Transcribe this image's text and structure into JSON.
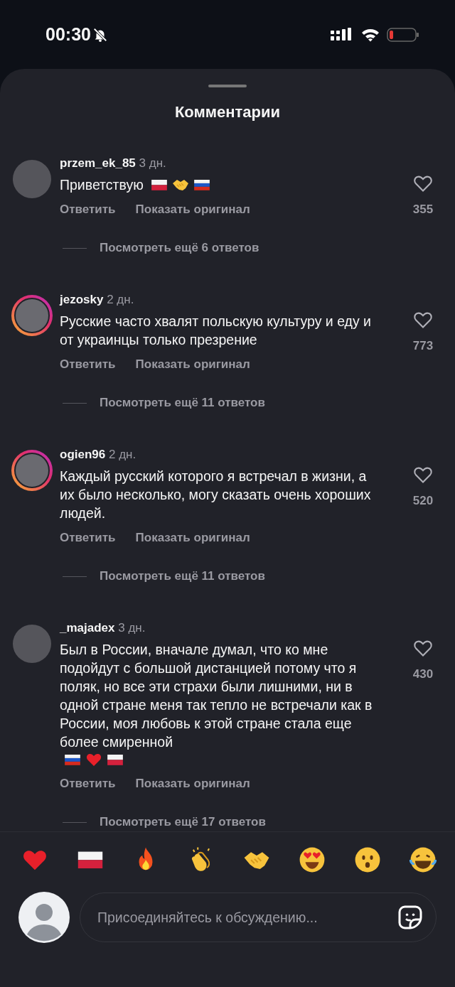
{
  "status_bar": {
    "time": "00:30",
    "silent": true
  },
  "sheet": {
    "title": "Комментарии"
  },
  "comments": [
    {
      "username": "przem_ek_85",
      "age": "3 дн.",
      "story_ring": false,
      "text": "Приветствую",
      "emojis": [
        {
          "kind": "flag-pl"
        },
        {
          "kind": "handshake"
        },
        {
          "kind": "flag-ru"
        }
      ],
      "reply": "Ответить",
      "translate": "Показать оригинал",
      "likes": "355",
      "liked": false,
      "more_replies": "Посмотреть ещё 6 ответов"
    },
    {
      "username": "jezosky",
      "age": "2 дн.",
      "story_ring": true,
      "text": "Русские часто хвалят польскую культуру и еду и от украинцы только презрение",
      "reply": "Ответить",
      "translate": "Показать оригинал",
      "likes": "773",
      "liked": false,
      "more_replies": "Посмотреть ещё 11 ответов"
    },
    {
      "username": "ogien96",
      "age": "2 дн.",
      "story_ring": true,
      "text": "Каждый русский которого я встречал в жизни, а их было несколько, могу сказать очень хороших людей.",
      "reply": "Ответить",
      "translate": "Показать оригинал",
      "likes": "520",
      "liked": false,
      "more_replies": "Посмотреть ещё 11 ответов"
    },
    {
      "username": "_majadex",
      "age": "3 дн.",
      "story_ring": false,
      "text": "Был в России, вначале думал, что ко мне подойдут с большой дистанцией потому что я поляк, но все эти страхи были лишними, ни в одной стране меня так тепло не встречали как в России, моя любовь к этой стране стала еще более смиренной",
      "emojis": [
        {
          "kind": "flag-ru"
        },
        {
          "kind": "heart"
        },
        {
          "kind": "flag-pl"
        }
      ],
      "reply": "Ответить",
      "translate": "Показать оригинал",
      "likes": "430",
      "liked": false,
      "more_replies": "Посмотреть ещё 17 ответов"
    }
  ],
  "quick_reactions": [
    {
      "kind": "heart"
    },
    {
      "kind": "flag-pl"
    },
    {
      "kind": "fire"
    },
    {
      "kind": "clap"
    },
    {
      "kind": "handshake"
    },
    {
      "kind": "heart-eyes"
    },
    {
      "kind": "surprised"
    },
    {
      "kind": "laugh"
    }
  ],
  "composer": {
    "placeholder": "Присоединяйтесь к обсуждению..."
  }
}
